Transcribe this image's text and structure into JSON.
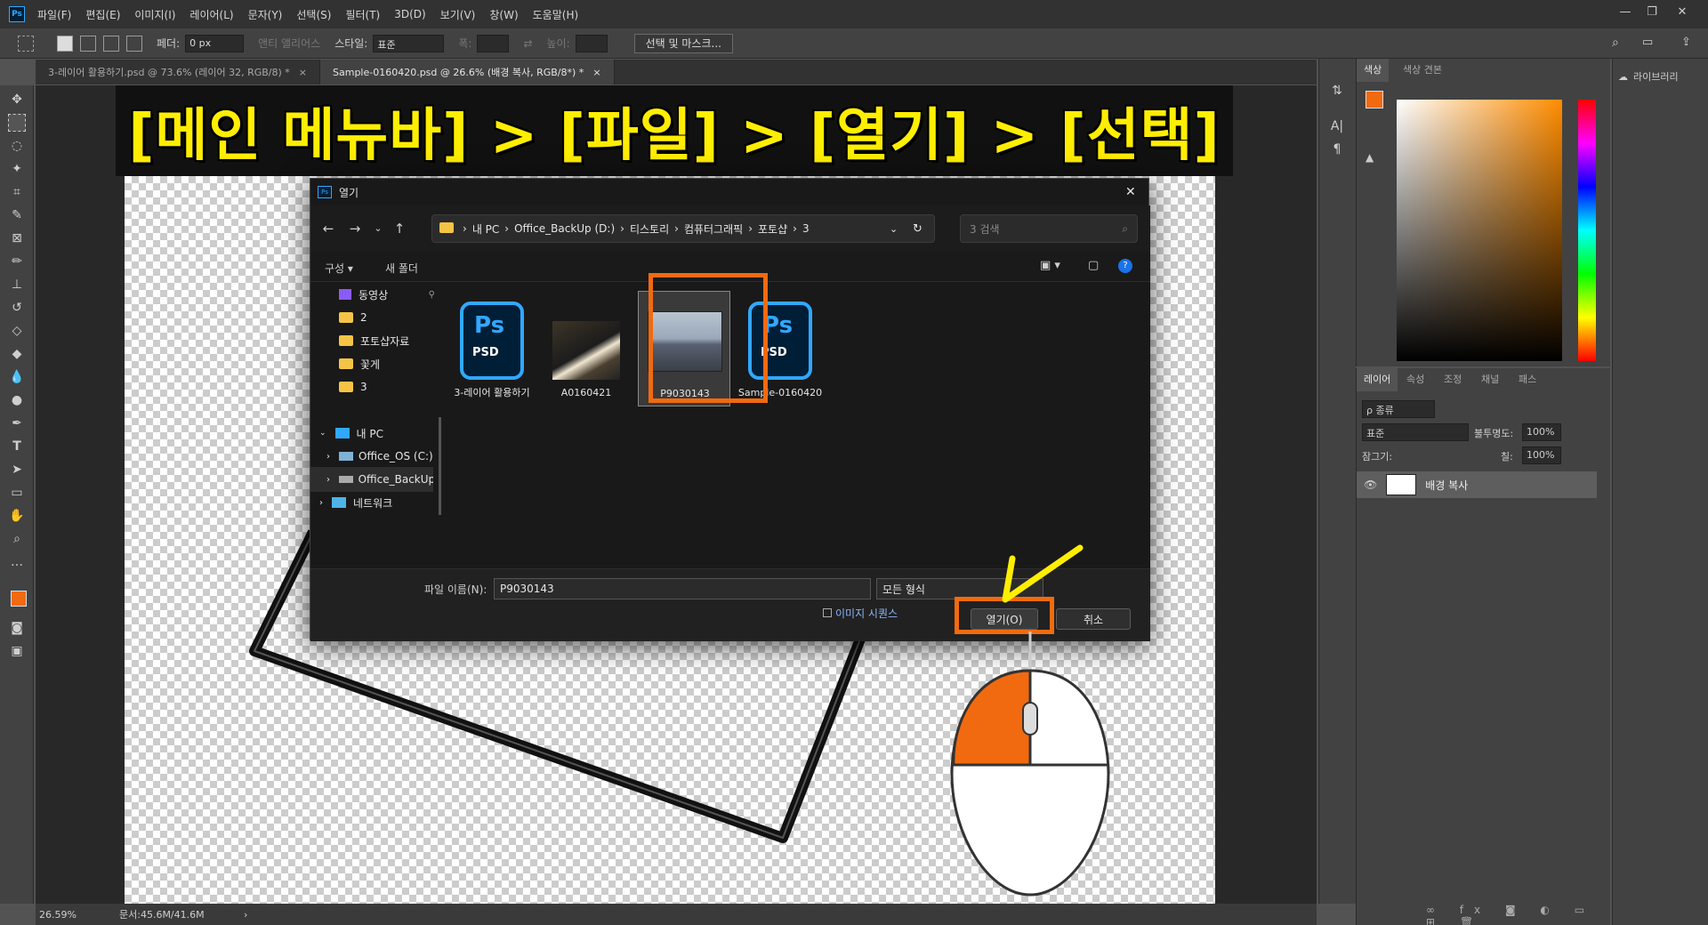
{
  "app": {
    "logo": "Ps",
    "menus": [
      "파일(F)",
      "편집(E)",
      "이미지(I)",
      "레이어(L)",
      "문자(Y)",
      "선택(S)",
      "필터(T)",
      "3D(D)",
      "보기(V)",
      "창(W)",
      "도움말(H)"
    ],
    "window_controls": [
      "—",
      "❐",
      "✕"
    ]
  },
  "options": {
    "feather_label": "페더:",
    "feather_value": "0 px",
    "antialias_label": "앤티 앨리어스",
    "style_label": "스타일:",
    "style_value": "표준",
    "width_label": "폭:",
    "height_label": "높이:",
    "select_mask_button": "선택 및 마스크..."
  },
  "doc_tabs": [
    {
      "label": "3-레이어 활용하기.psd @ 73.6% (레이어 32, RGB/8) *",
      "close": "×"
    },
    {
      "label": "Sample-0160420.psd @ 26.6% (배경 복사, RGB/8*) *",
      "close": "×"
    }
  ],
  "banner": {
    "text": "[메인 메뉴바] > [파일] > [열기] > [선택]"
  },
  "status": {
    "zoom": "26.59%",
    "doc_size": "문서:45.6M/41.6M",
    "arrow": "›"
  },
  "color_panel": {
    "tabs": [
      "색상",
      "색상 견본"
    ]
  },
  "layers_panel": {
    "tabs": [
      "레이어",
      "속성",
      "조정",
      "채널",
      "패스"
    ],
    "kind_filter": "ρ 종류",
    "blend_mode": "표준",
    "opacity_label": "불투명도:",
    "opacity_value": "100%",
    "lock_label": "잠그기:",
    "fill_label": "칠:",
    "fill_value": "100%",
    "layers": [
      {
        "name": "배경 복사"
      }
    ]
  },
  "libraries": {
    "label": "라이브러리"
  },
  "dialog": {
    "title": "열기",
    "breadcrumb": [
      "내 PC",
      "Office_BackUp (D:)",
      "티스토리",
      "컴퓨터그래픽",
      "포토샵",
      "3"
    ],
    "search_placeholder": "3 검색",
    "organize": "구성 ▾",
    "new_folder": "새 폴더",
    "nav_items": [
      {
        "label": "동영상"
      },
      {
        "label": "2"
      },
      {
        "label": "포토샵자료"
      },
      {
        "label": "꽃게"
      },
      {
        "label": "3"
      },
      {
        "label": "내 PC"
      },
      {
        "label": "Office_OS (C:)"
      },
      {
        "label": "Office_BackUp"
      },
      {
        "label": "네트워크"
      }
    ],
    "files": [
      {
        "name": "3-레이어 활용하기",
        "type": "PSD",
        "badge": "Ps"
      },
      {
        "name": "A0160421",
        "type": "photo"
      },
      {
        "name": "P9030143",
        "type": "photo"
      },
      {
        "name": "Sample-0160420",
        "type": "PSD",
        "badge": "Ps"
      }
    ],
    "filename_label": "파일 이름(N):",
    "filename_value": "P9030143",
    "filetype_value": "모든 형식",
    "preview_label": "이미지 시퀀스",
    "open_button": "열기(O)",
    "cancel_button": "취소"
  },
  "colors": {
    "accent": "#f26a0f",
    "banner_text": "#ffee00",
    "psd_blue": "#31a8ff"
  }
}
